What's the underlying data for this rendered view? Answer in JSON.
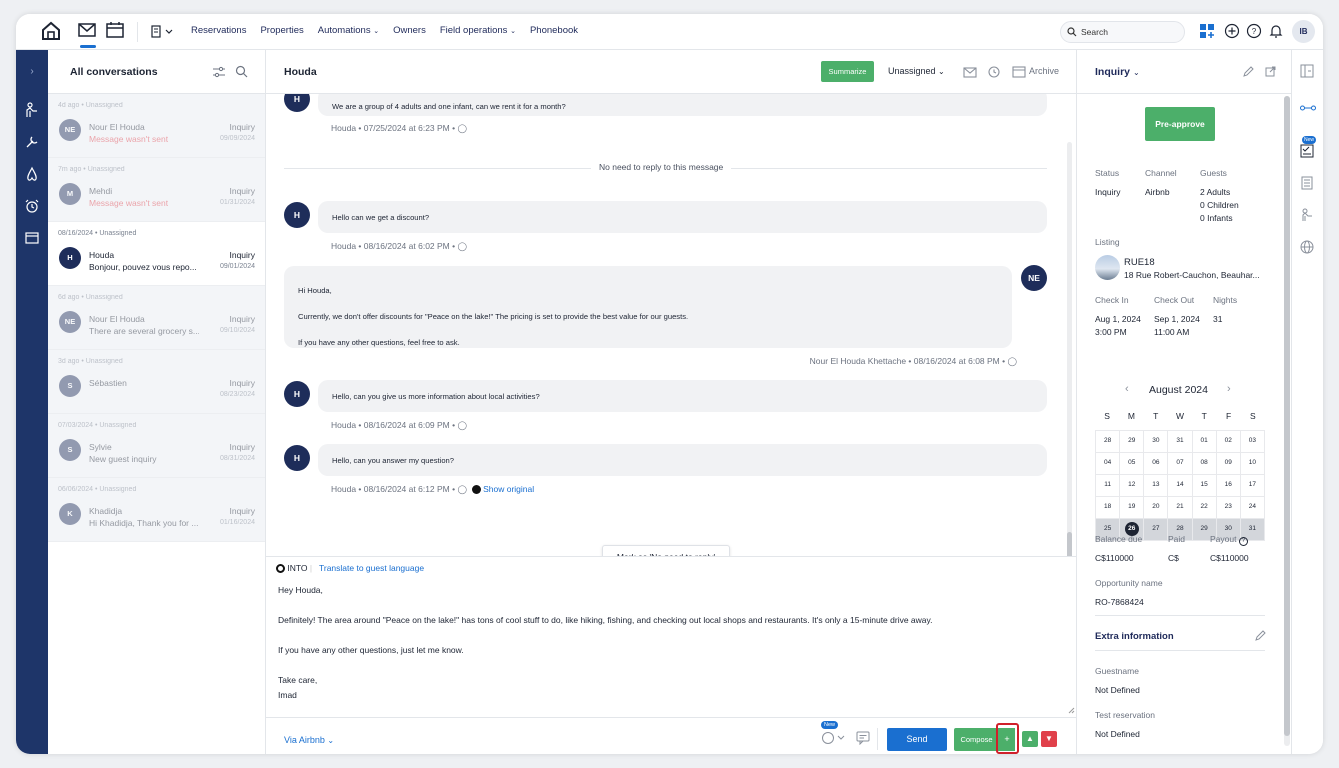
{
  "topnav": {
    "links": [
      "Reservations",
      "Properties",
      "Automations",
      "Owners",
      "Field operations",
      "Phonebook"
    ],
    "search_placeholder": "Search",
    "user_initials": "IB"
  },
  "conversations": {
    "title": "All conversations",
    "items": [
      {
        "meta": "4d ago • Unassigned",
        "initials": "NE",
        "name": "Nour El Houda",
        "type": "Inquiry",
        "snippet": "Message wasn't sent",
        "date": "09/09/2024",
        "error": true,
        "active": false
      },
      {
        "meta": "7m ago • Unassigned",
        "initials": "M",
        "name": "Mehdi",
        "type": "Inquiry",
        "snippet": "Message wasn't sent",
        "date": "01/31/2024",
        "error": true,
        "active": false
      },
      {
        "meta": "08/16/2024 • Unassigned",
        "initials": "H",
        "name": "Houda",
        "type": "Inquiry",
        "snippet": "Bonjour, pouvez vous repo...",
        "date": "09/01/2024",
        "error": false,
        "active": true
      },
      {
        "meta": "6d ago • Unassigned",
        "initials": "NE",
        "name": "Nour El Houda",
        "type": "Inquiry",
        "snippet": "There are several grocery s...",
        "date": "09/10/2024",
        "error": false,
        "active": false
      },
      {
        "meta": "3d ago • Unassigned",
        "initials": "S",
        "name": "Sébastien",
        "type": "Inquiry",
        "snippet": "",
        "date": "08/23/2024",
        "error": false,
        "active": false
      },
      {
        "meta": "07/03/2024 • Unassigned",
        "initials": "S",
        "name": "Sylvie",
        "type": "Inquiry",
        "snippet": "New guest inquiry",
        "date": "08/31/2024",
        "error": false,
        "active": false
      },
      {
        "meta": "06/06/2024 • Unassigned",
        "initials": "K",
        "name": "Khadidja",
        "type": "Inquiry",
        "snippet": "Hi Khadidja, Thank you for ...",
        "date": "01/16/2024",
        "error": false,
        "active": false
      }
    ]
  },
  "chat": {
    "name": "Houda",
    "summarize": "Summarize",
    "assignee": "Unassigned",
    "archive": "Archive",
    "messages": {
      "m1_text": "We are a group of 4 adults and one infant, can we rent it for a month?",
      "m1_meta": "Houda • 07/25/2024 at 6:23 PM •",
      "divider": "No need to reply to this message",
      "m2_text": "Hello can we get a discount?",
      "m2_meta": "Houda • 08/16/2024 at 6:02 PM •",
      "m3_l1": "Hi Houda,",
      "m3_l2": "Currently, we don't offer discounts for \"Peace on the lake!\" The pricing is set to provide the best value for our guests.",
      "m3_l3": "If you have any other questions, feel free to ask.",
      "m3_meta": "Nour El Houda Khettache • 08/16/2024 at 6:08 PM •",
      "m3_initials": "NE",
      "m4_text": "Hello, can you give us more information about local activities?",
      "m4_meta": "Houda • 08/16/2024 at 6:09 PM •",
      "m5_text": "Hello, can you answer my question?",
      "m5_meta": "Houda • 08/16/2024 at 6:12 PM •",
      "show_original": "Show original",
      "guest_initials": "H"
    },
    "mark_no_reply": "Mark as 'No need to reply'",
    "composer": {
      "into": "INTO",
      "translate": "Translate to guest language",
      "greeting": "Hey Houda,",
      "body": "Definitely! The area around \"Peace on the lake!\" has tons of cool stuff to do, like hiking, fishing, and checking out local shops and restaurants. It's only a 15-minute drive away.",
      "closing_q": "If you have any other questions, just let me know.",
      "signoff": "Take care,",
      "signature": "Imad",
      "via": "Via Airbnb",
      "new_badge": "New",
      "send": "Send",
      "compose": "Compose",
      "plus": "+"
    }
  },
  "panel": {
    "title": "Inquiry",
    "preapprove": "Pre-approve",
    "status_label": "Status",
    "status": "Inquiry",
    "channel_label": "Channel",
    "channel": "Airbnb",
    "guests_label": "Guests",
    "adults": "2 Adults",
    "children": "0 Children",
    "infants": "0 Infants",
    "listing_label": "Listing",
    "listing_name": "RUE18",
    "listing_address": "18 Rue Robert-Cauchon, Beauhar...",
    "checkin_label": "Check In",
    "checkin_date": "Aug 1, 2024",
    "checkin_time": "3:00 PM",
    "checkout_label": "Check Out",
    "checkout_date": "Sep 1, 2024",
    "checkout_time": "11:00 AM",
    "nights_label": "Nights",
    "nights": "31",
    "calendar": {
      "month": "August 2024",
      "dows": [
        "S",
        "M",
        "T",
        "W",
        "T",
        "F",
        "S"
      ],
      "rows": [
        [
          "28",
          "29",
          "30",
          "31",
          "01",
          "02",
          "03"
        ],
        [
          "04",
          "05",
          "06",
          "07",
          "08",
          "09",
          "10"
        ],
        [
          "11",
          "12",
          "13",
          "14",
          "15",
          "16",
          "17"
        ],
        [
          "18",
          "19",
          "20",
          "21",
          "22",
          "23",
          "24"
        ],
        [
          "25",
          "26",
          "27",
          "28",
          "29",
          "30",
          "31"
        ]
      ],
      "today": "26"
    },
    "balance_label": "Balance due",
    "balance": "C$110000",
    "paid_label": "Paid",
    "paid": "C$",
    "payout_label": "Payout",
    "payout": "C$110000",
    "opp_label": "Opportunity name",
    "opp": "RO-7868424",
    "extra_title": "Extra information",
    "guestname_label": "Guestname",
    "guestname": "Not Defined",
    "test_label": "Test reservation",
    "test": "Not Defined"
  },
  "right_rail": {
    "new_badge": "New"
  },
  "colors": {
    "navy": "#1e3569",
    "green": "#4caf6a",
    "blue": "#1a6fd0",
    "red": "#e0404a",
    "highlight": "#d0202a"
  }
}
